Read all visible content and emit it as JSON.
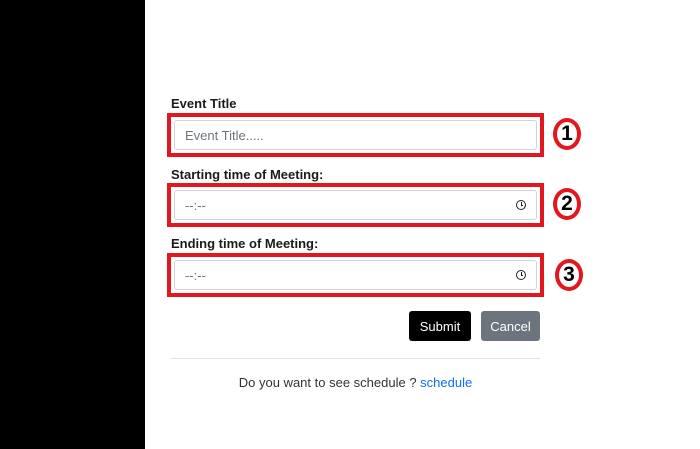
{
  "form": {
    "event_title": {
      "label": "Event Title",
      "placeholder": "Event Title.....",
      "badge": "1"
    },
    "start_time": {
      "label": "Starting time of Meeting:",
      "value": "--:--",
      "badge": "2",
      "icon": "clock-icon"
    },
    "end_time": {
      "label": "Ending time of Meeting:",
      "value": "--:--",
      "badge": "3",
      "icon": "clock-icon"
    },
    "buttons": {
      "submit": "Submit",
      "cancel": "Cancel"
    }
  },
  "footer": {
    "prompt": "Do you want to see schedule ?",
    "link": "schedule"
  },
  "colors": {
    "highlight": "#e3171f",
    "submit_bg": "#000000",
    "cancel_bg": "#6c757d",
    "link": "#0d6efd"
  }
}
